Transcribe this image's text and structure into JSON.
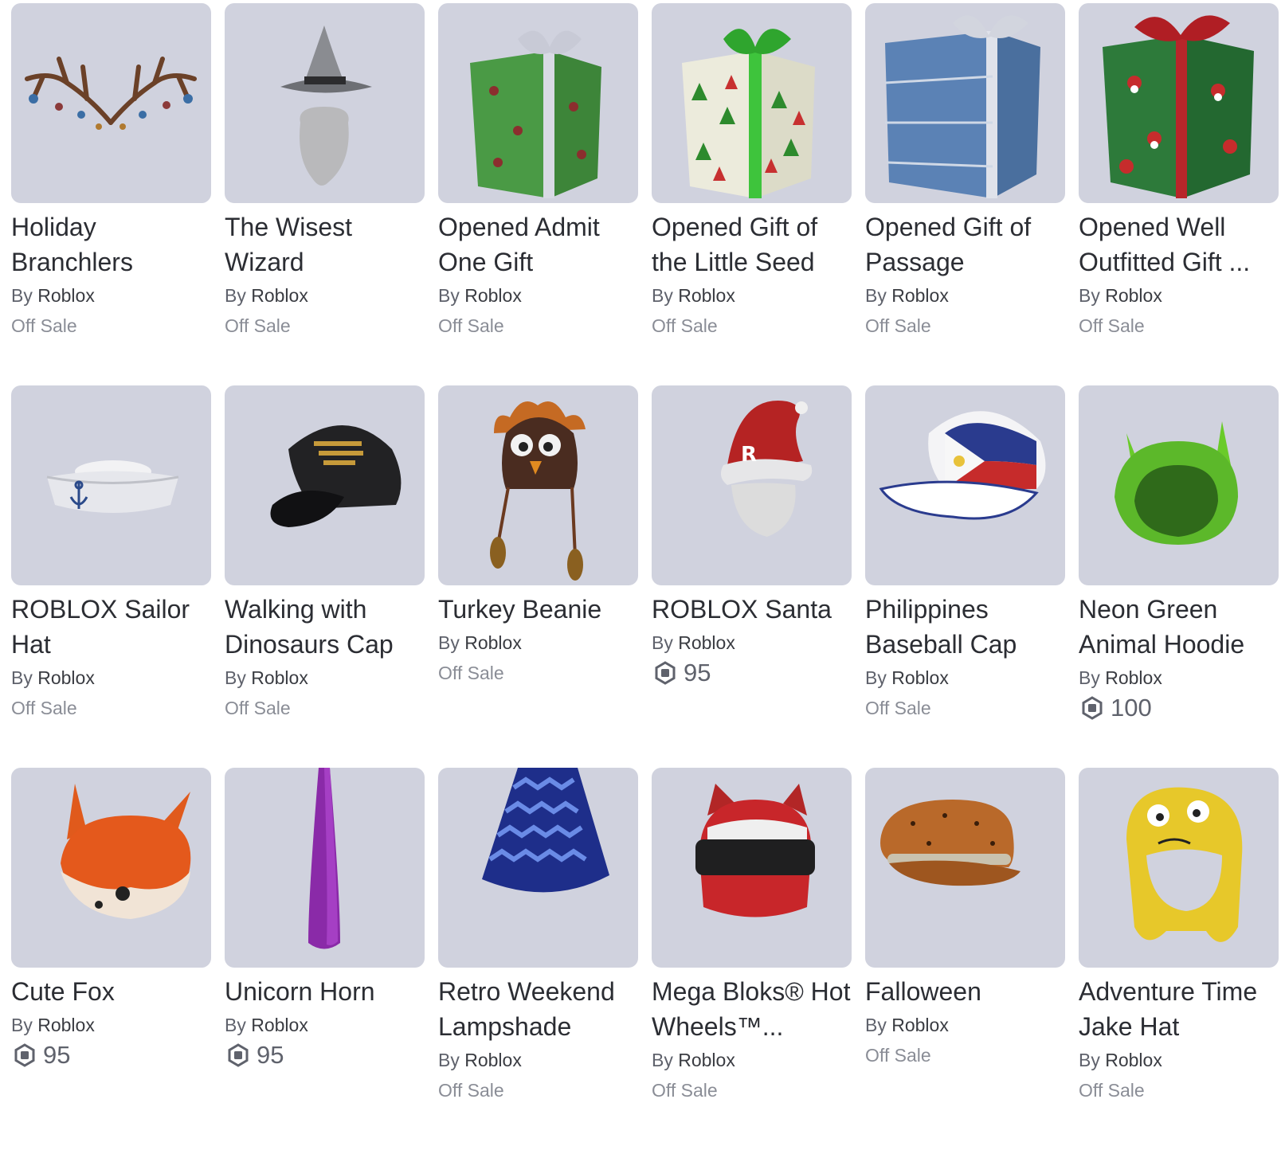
{
  "catalog": {
    "items": [
      {
        "name": "Holiday Branchlers",
        "by": "By",
        "creator": "Roblox",
        "price_text": "Off Sale",
        "robux": null,
        "icon": "antlers-thumbnail"
      },
      {
        "name": "The Wisest Wizard",
        "by": "By",
        "creator": "Roblox",
        "price_text": "Off Sale",
        "robux": null,
        "icon": "wizard-hat-thumbnail"
      },
      {
        "name": "Opened Admit One Gift",
        "by": "By",
        "creator": "Roblox",
        "price_text": "Off Sale",
        "robux": null,
        "icon": "green-gift-thumbnail"
      },
      {
        "name": "Opened Gift of the Little Seed",
        "by": "By",
        "creator": "Roblox",
        "price_text": "Off Sale",
        "robux": null,
        "icon": "tree-gift-thumbnail"
      },
      {
        "name": "Opened Gift of Passage",
        "by": "By",
        "creator": "Roblox",
        "price_text": "Off Sale",
        "robux": null,
        "icon": "blue-gift-thumbnail"
      },
      {
        "name": "Opened Well Outfitted Gift ...",
        "by": "By",
        "creator": "Roblox",
        "price_text": "Off Sale",
        "robux": null,
        "icon": "santa-gift-thumbnail"
      },
      {
        "name": "ROBLOX Sailor Hat",
        "by": "By",
        "creator": "Roblox",
        "price_text": "Off Sale",
        "robux": null,
        "icon": "sailor-hat-thumbnail"
      },
      {
        "name": "Walking with Dinosaurs Cap",
        "by": "By",
        "creator": "Roblox",
        "price_text": "Off Sale",
        "robux": null,
        "icon": "black-cap-thumbnail"
      },
      {
        "name": "Turkey Beanie",
        "by": "By",
        "creator": "Roblox",
        "price_text": "Off Sale",
        "robux": null,
        "icon": "turkey-beanie-thumbnail"
      },
      {
        "name": "ROBLOX Santa",
        "by": "By",
        "creator": "Roblox",
        "price_text": "",
        "robux": "95",
        "icon": "santa-hat-thumbnail"
      },
      {
        "name": "Philippines Baseball Cap",
        "by": "By",
        "creator": "Roblox",
        "price_text": "Off Sale",
        "robux": null,
        "icon": "flag-cap-thumbnail"
      },
      {
        "name": "Neon Green Animal Hoodie",
        "by": "By",
        "creator": "Roblox",
        "price_text": "",
        "robux": "100",
        "icon": "green-hoodie-thumbnail"
      },
      {
        "name": "Cute Fox",
        "by": "By",
        "creator": "Roblox",
        "price_text": "",
        "robux": "95",
        "icon": "fox-head-thumbnail"
      },
      {
        "name": "Unicorn Horn",
        "by": "By",
        "creator": "Roblox",
        "price_text": "",
        "robux": "95",
        "icon": "unicorn-horn-thumbnail"
      },
      {
        "name": "Retro Weekend Lampshade",
        "by": "By",
        "creator": "Roblox",
        "price_text": "Off Sale",
        "robux": null,
        "icon": "lampshade-thumbnail"
      },
      {
        "name": "Mega Bloks® Hot Wheels™...",
        "by": "By",
        "creator": "Roblox",
        "price_text": "Off Sale",
        "robux": null,
        "icon": "helmet-thumbnail"
      },
      {
        "name": "Falloween",
        "by": "By",
        "creator": "Roblox",
        "price_text": "Off Sale",
        "robux": null,
        "icon": "newsboy-cap-thumbnail"
      },
      {
        "name": "Adventure Time Jake Hat",
        "by": "By",
        "creator": "Roblox",
        "price_text": "Off Sale",
        "robux": null,
        "icon": "jake-hat-thumbnail"
      }
    ]
  },
  "colors": {
    "thumb_bg": "#d0d2de",
    "name_text": "#2b2d33",
    "muted_text": "#8a8d96"
  }
}
